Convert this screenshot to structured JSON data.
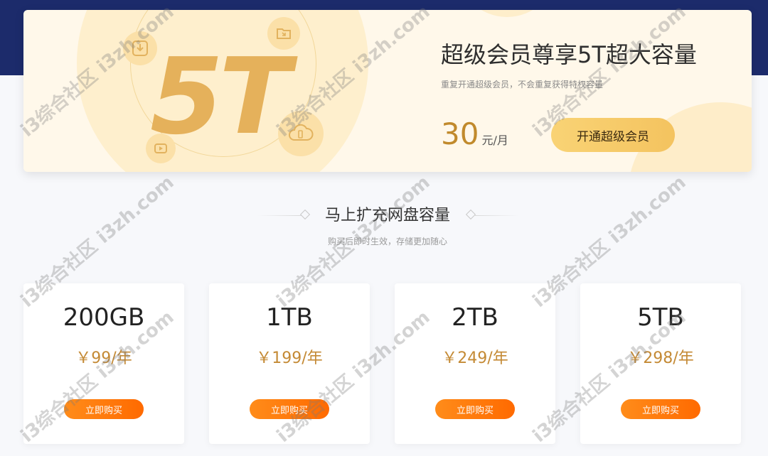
{
  "hero": {
    "big_text": "5T",
    "title": "超级会员尊享5T超大容量",
    "subtitle": "重复开通超级会员，不会重复获得特权容量",
    "price_amount": "30",
    "price_unit": "元/月",
    "cta_label": "开通超级会员",
    "icons": [
      "download-icon",
      "folder-icon",
      "video-icon",
      "cloud-storage-icon"
    ]
  },
  "section": {
    "title": "马上扩充网盘容量",
    "subtitle": "购买后即时生效，存储更加随心"
  },
  "plans": [
    {
      "size": "200GB",
      "price": "￥99/年",
      "button": "立即购买"
    },
    {
      "size": "1TB",
      "price": "￥199/年",
      "button": "立即购买"
    },
    {
      "size": "2TB",
      "price": "￥249/年",
      "button": "立即购买"
    },
    {
      "size": "5TB",
      "price": "￥298/年",
      "button": "立即购买"
    }
  ],
  "watermark": "i3综合社区 i3zh.com",
  "colors": {
    "top_band": "#1c2b6b",
    "price_gold": "#c48a35",
    "buy_orange": "#ff7a0d",
    "cta_gold": "#f6c966"
  }
}
